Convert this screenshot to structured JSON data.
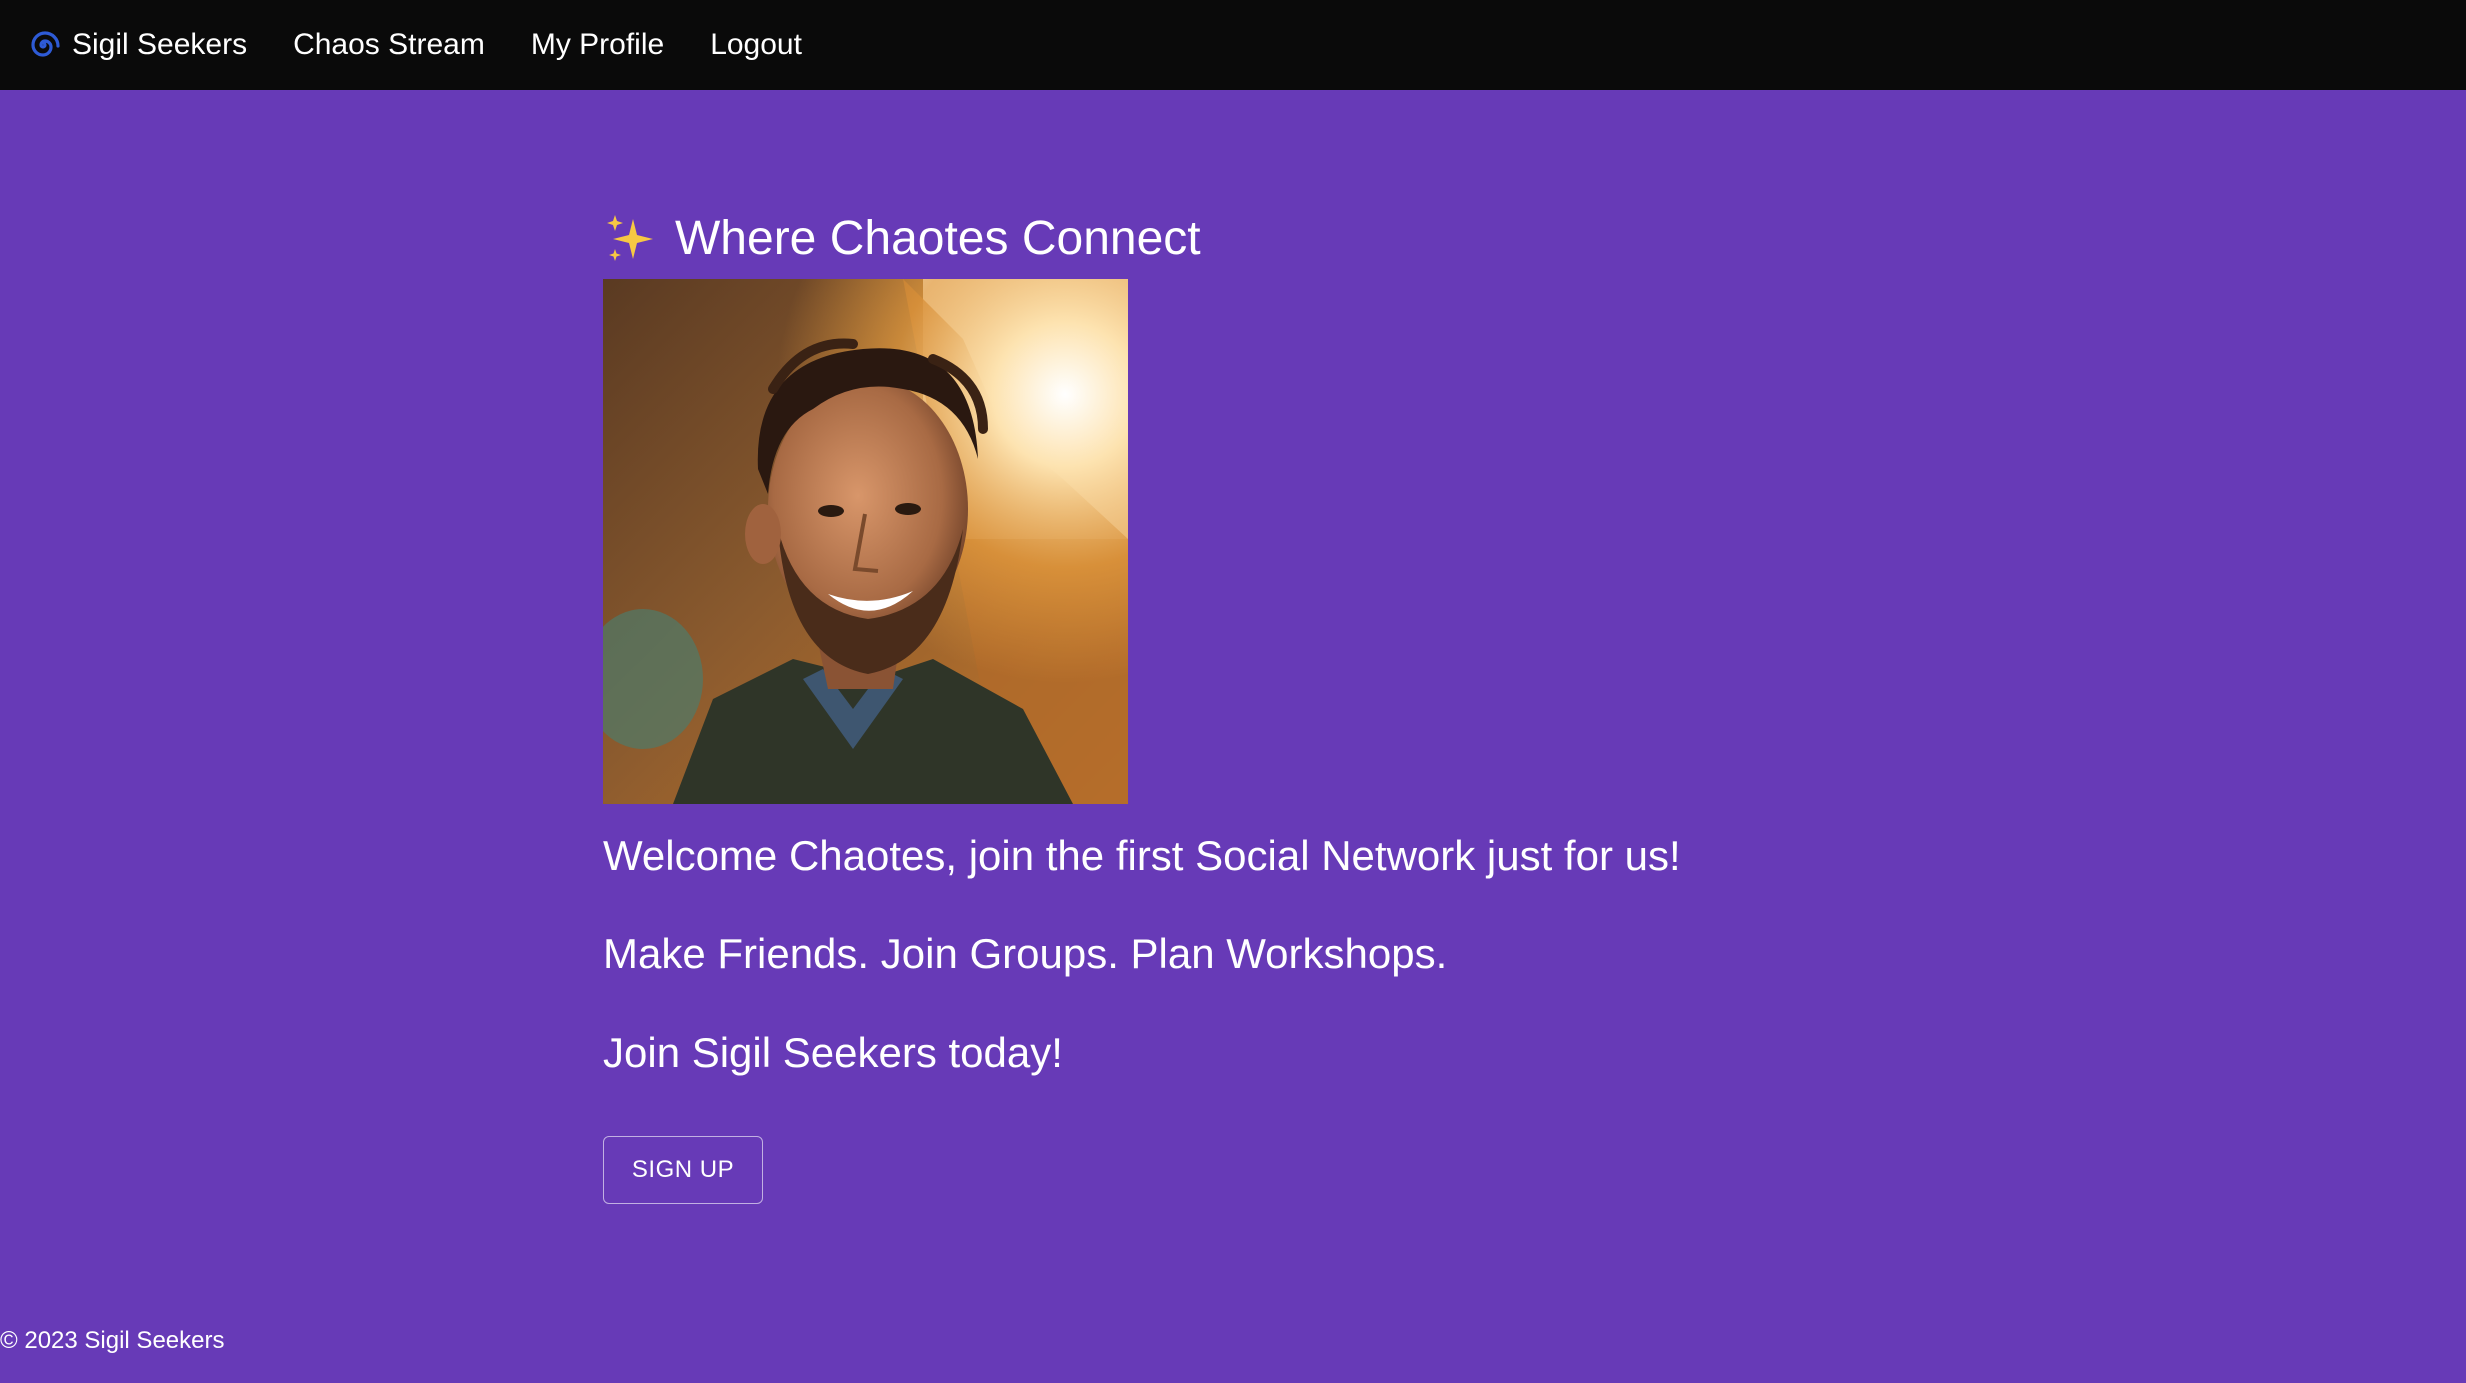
{
  "nav": {
    "brand_label": "Sigil Seekers",
    "brand_icon": "spiral-icon",
    "links": [
      {
        "label": "Chaos Stream"
      },
      {
        "label": "My Profile"
      },
      {
        "label": "Logout"
      }
    ]
  },
  "main": {
    "headline_icon": "sparkles-icon",
    "headline": "Where Chaotes Connect",
    "paragraphs": [
      "Welcome Chaotes, join the first Social Network just for us!",
      "Make Friends. Join Groups. Plan Workshops.",
      "Join Sigil Seekers today!"
    ],
    "signup_label": "SIGN UP"
  },
  "footer": {
    "text": "© 2023 Sigil Seekers"
  },
  "colors": {
    "background": "#673ab7",
    "navbar": "#0a0a0a",
    "text": "#ffffff",
    "brand_icon": "#2e5bd6",
    "sparkle": "#f7c843"
  }
}
